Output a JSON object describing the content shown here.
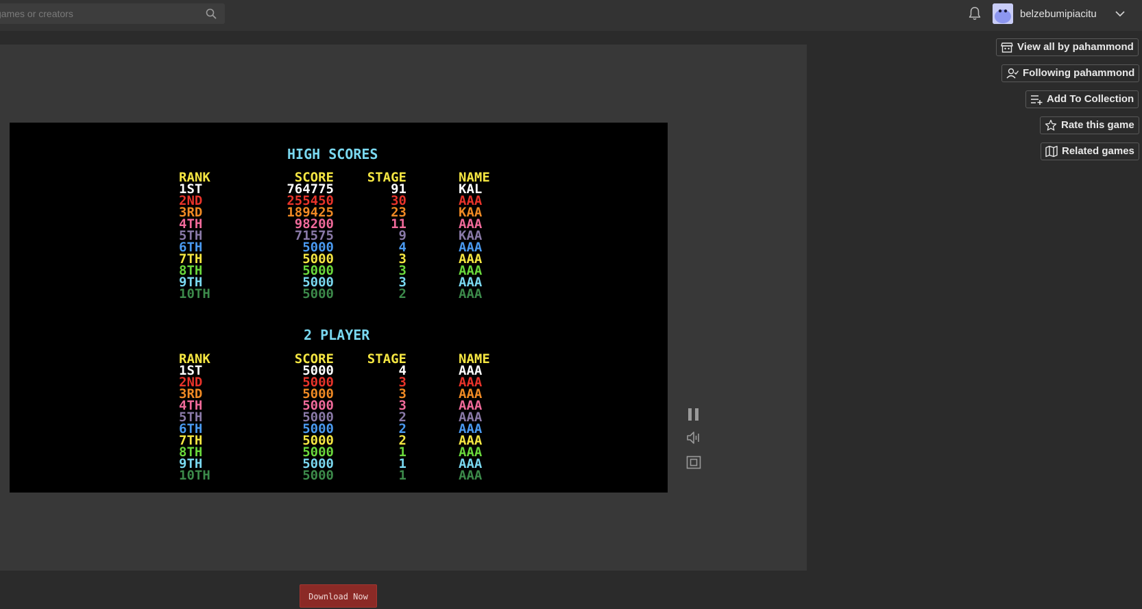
{
  "search": {
    "placeholder": "games or creators"
  },
  "user": {
    "name": "belzebumipiacitu"
  },
  "sidebar": {
    "view_all": "View all by pahammond",
    "following": "Following pahammond",
    "add_collection": "Add To Collection",
    "rate": "Rate this game",
    "related": "Related games"
  },
  "download": {
    "label": "Download Now"
  },
  "game": {
    "title": "HIGH SCORES",
    "two_player_title": "2 PLAYER",
    "headers": {
      "rank": "RANK",
      "score": "SCORE",
      "stage": "STAGE",
      "name": "NAME"
    },
    "colors": [
      "#ffffff",
      "#e8332a",
      "#f08a24",
      "#f06a9a",
      "#8a7aa8",
      "#4a9af0",
      "#f5e642",
      "#6ad83c",
      "#7ad8f0",
      "#3c8a4a"
    ],
    "header_color": "#f5e642",
    "title_color": "#7ad8f0",
    "single": [
      {
        "rank": "1ST",
        "score": "764775",
        "stage": "91",
        "name": "KAL"
      },
      {
        "rank": "2ND",
        "score": "255450",
        "stage": "30",
        "name": "AAA"
      },
      {
        "rank": "3RD",
        "score": "189425",
        "stage": "23",
        "name": "KAA"
      },
      {
        "rank": "4TH",
        "score": "98200",
        "stage": "11",
        "name": "AAA"
      },
      {
        "rank": "5TH",
        "score": "71575",
        "stage": "9",
        "name": "KAA"
      },
      {
        "rank": "6TH",
        "score": "5000",
        "stage": "4",
        "name": "AAA"
      },
      {
        "rank": "7TH",
        "score": "5000",
        "stage": "3",
        "name": "AAA"
      },
      {
        "rank": "8TH",
        "score": "5000",
        "stage": "3",
        "name": "AAA"
      },
      {
        "rank": "9TH",
        "score": "5000",
        "stage": "3",
        "name": "AAA"
      },
      {
        "rank": "10TH",
        "score": "5000",
        "stage": "2",
        "name": "AAA"
      }
    ],
    "two_player": [
      {
        "rank": "1ST",
        "score": "5000",
        "stage": "4",
        "name": "AAA"
      },
      {
        "rank": "2ND",
        "score": "5000",
        "stage": "3",
        "name": "AAA"
      },
      {
        "rank": "3RD",
        "score": "5000",
        "stage": "3",
        "name": "AAA"
      },
      {
        "rank": "4TH",
        "score": "5000",
        "stage": "3",
        "name": "AAA"
      },
      {
        "rank": "5TH",
        "score": "5000",
        "stage": "2",
        "name": "AAA"
      },
      {
        "rank": "6TH",
        "score": "5000",
        "stage": "2",
        "name": "AAA"
      },
      {
        "rank": "7TH",
        "score": "5000",
        "stage": "2",
        "name": "AAA"
      },
      {
        "rank": "8TH",
        "score": "5000",
        "stage": "1",
        "name": "AAA"
      },
      {
        "rank": "9TH",
        "score": "5000",
        "stage": "1",
        "name": "AAA"
      },
      {
        "rank": "10TH",
        "score": "5000",
        "stage": "1",
        "name": "AAA"
      }
    ]
  }
}
